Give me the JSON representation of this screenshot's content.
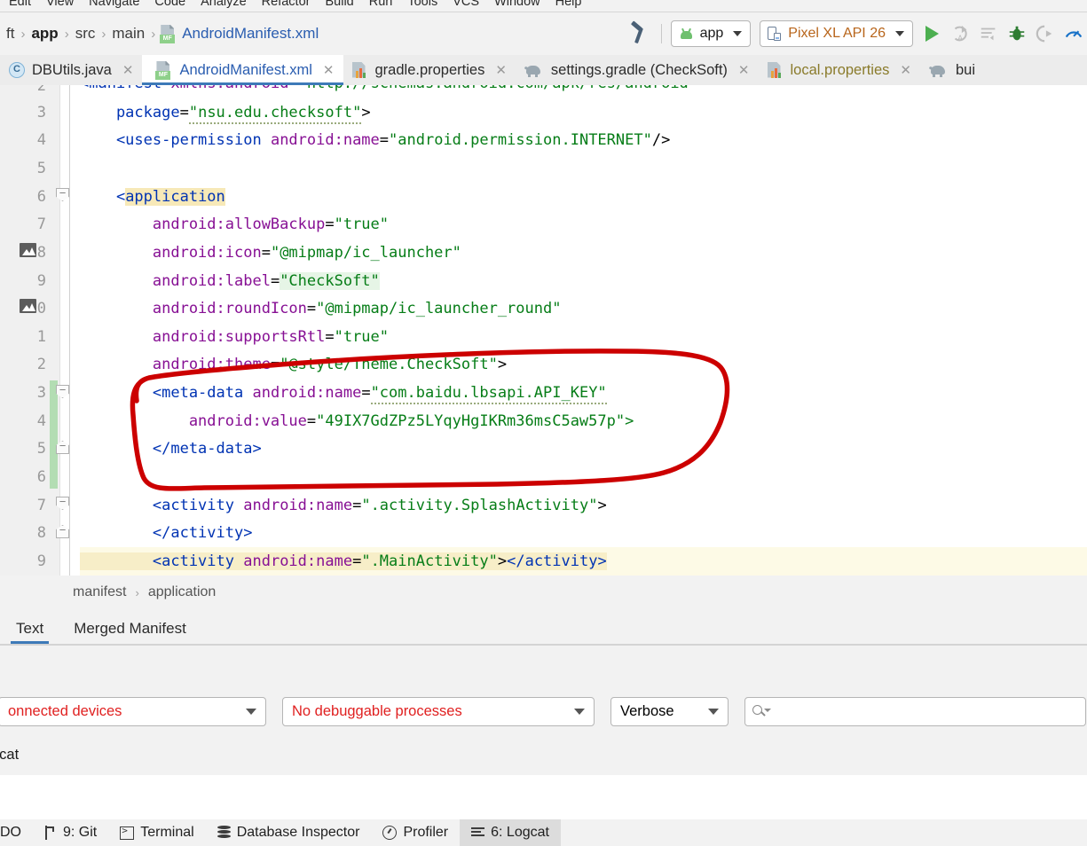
{
  "menu": {
    "items": [
      "Edit",
      "View",
      "Navigate",
      "Code",
      "Analyze",
      "Refactor",
      "Build",
      "Run",
      "Tools",
      "VCS",
      "Window",
      "Help"
    ]
  },
  "navigation": {
    "breadcrumb": [
      {
        "label": "ft",
        "bold": false
      },
      {
        "label": "app",
        "bold": true
      },
      {
        "label": "src",
        "bold": false
      },
      {
        "label": "main",
        "bold": false
      }
    ],
    "separator": "›",
    "current_file": "AndroidManifest.xml",
    "file_icon": "manifest-file-icon",
    "file_icon_text": "MF"
  },
  "toolbar": {
    "build_icon": "hammer-build-icon",
    "run_config": "app",
    "run_config_icon": "android-robot-icon",
    "device": "Pixel XL API 26",
    "device_icon": "device-phone-icon",
    "run_icon": "run-play-icon",
    "apply_changes_icon": "apply-changes-icon",
    "apply_code_changes_icon": "apply-code-changes-icon",
    "debug_icon": "debug-bug-icon",
    "attach_debugger_icon": "attach-debugger-icon",
    "profiler_icon": "profiler-icon"
  },
  "editor_tabs": [
    {
      "label": "DBUtils.java",
      "icon": "java-class-icon",
      "color": "dark",
      "active": false,
      "closable": true
    },
    {
      "label": "AndroidManifest.xml",
      "icon": "manifest-file-icon",
      "color": "blue",
      "active": true,
      "closable": true
    },
    {
      "label": "gradle.properties",
      "icon": "properties-file-icon",
      "color": "dark",
      "active": false,
      "closable": true
    },
    {
      "label": "settings.gradle (CheckSoft)",
      "icon": "gradle-elephant-icon",
      "color": "dark",
      "active": false,
      "closable": true
    },
    {
      "label": "local.properties",
      "icon": "properties-file-icon",
      "color": "olive",
      "active": false,
      "closable": true
    },
    {
      "label": "bui",
      "icon": "gradle-elephant-icon",
      "color": "dark",
      "active": false,
      "closable": false
    }
  ],
  "editor": {
    "file": "AndroidManifest.xml",
    "line_numbers": [
      "2",
      "3",
      "4",
      "5",
      "6",
      "7",
      "8",
      "9",
      "0",
      "1",
      "2",
      "3",
      "4",
      "5",
      "6",
      "7",
      "8",
      "9"
    ],
    "lines": [
      {
        "num": "2",
        "clipped_top": true,
        "text": "<manifest xmlns:android=\"http://schemas.android.com/apk/res/android"
      },
      {
        "num": "3",
        "text": "    package=\"nsu.edu.checksoft\">"
      },
      {
        "num": "4",
        "text": "    <uses-permission android:name=\"android.permission.INTERNET\"/>"
      },
      {
        "num": "5",
        "text": ""
      },
      {
        "num": "6",
        "text": "    <application",
        "fold": "top",
        "highlight": "application"
      },
      {
        "num": "7",
        "text": "        android:allowBackup=\"true\""
      },
      {
        "num": "8",
        "text": "        android:icon=\"@mipmap/ic_launcher\"",
        "gutter_icon": "image-resource-icon"
      },
      {
        "num": "9",
        "text": "        android:label=\"CheckSoft\"",
        "value_highlight": "green"
      },
      {
        "num": "0",
        "text": "        android:roundIcon=\"@mipmap/ic_launcher_round\"",
        "gutter_icon": "image-resource-icon"
      },
      {
        "num": "1",
        "text": "        android:supportsRtl=\"true\""
      },
      {
        "num": "2",
        "text": "        android:theme=\"@style/Theme.CheckSoft\">"
      },
      {
        "num": "3",
        "text": "        <meta-data android:name=\"com.baidu.lbsapi.API_KEY\"",
        "fold": "top",
        "changed": true
      },
      {
        "num": "4",
        "text": "            android:value=\"49IX7GdZPz5LYqyHgIKRm36msC5aw57p\">",
        "changed": true
      },
      {
        "num": "5",
        "text": "        </meta-data>",
        "fold": "bottom",
        "changed": true
      },
      {
        "num": "6",
        "text": "",
        "caret_row": true,
        "changed": true
      },
      {
        "num": "7",
        "text": "        <activity android:name=\".activity.SplashActivity\">",
        "fold": "top"
      },
      {
        "num": "8",
        "text": "        </activity>",
        "fold": "bottom"
      },
      {
        "num": "9",
        "text": "        <activity android:name=\".MainActivity\"></activity>",
        "highlight_row": "yellow"
      }
    ],
    "api_key_value": "49IX7GdZPz5LYqyHgIKRm36msC5aw57p",
    "package_name": "nsu.edu.checksoft",
    "app_label": "CheckSoft",
    "meta_data_name": "com.baidu.lbsapi.API_KEY"
  },
  "annotation": {
    "shape": "hand-drawn-red-ellipse",
    "color": "#cc0000",
    "encircles": "meta-data block with Baidu API key"
  },
  "editor_breadcrumb": {
    "items": [
      "manifest",
      "application"
    ],
    "separator": "›"
  },
  "design_tabs": [
    {
      "label": "Text",
      "active": true
    },
    {
      "label": "Merged Manifest",
      "active": false
    }
  ],
  "logcat": {
    "title": "t",
    "panel_label": "gcat",
    "device_select": "onnected devices",
    "device_select_color": "#e02020",
    "process_select": "No debuggable processes",
    "process_select_color": "#e02020",
    "level_select": "Verbose",
    "search_placeholder": "",
    "search_icon": "search-magnifier-icon"
  },
  "status_bar": {
    "items": [
      {
        "label": "DO",
        "icon": null,
        "active": false
      },
      {
        "label": "9: Git",
        "icon": "git-branch-icon",
        "active": false
      },
      {
        "label": "Terminal",
        "icon": "terminal-icon",
        "active": false
      },
      {
        "label": "Database Inspector",
        "icon": "database-icon",
        "active": false
      },
      {
        "label": "Profiler",
        "icon": "profiler-gauge-icon",
        "active": false
      },
      {
        "label": "6: Logcat",
        "icon": "logcat-lines-icon",
        "active": true
      }
    ]
  },
  "colors": {
    "accent_blue": "#3d7ab8",
    "tag_blue": "#0033b3",
    "attr_purple": "#871094",
    "string_green": "#067d17",
    "annotation_red": "#cc0000",
    "error_red": "#e02020",
    "highlight_yellow": "#f7e9b8",
    "highlight_green": "#e6f5e6",
    "changebar_green": "#b3ddb3"
  }
}
